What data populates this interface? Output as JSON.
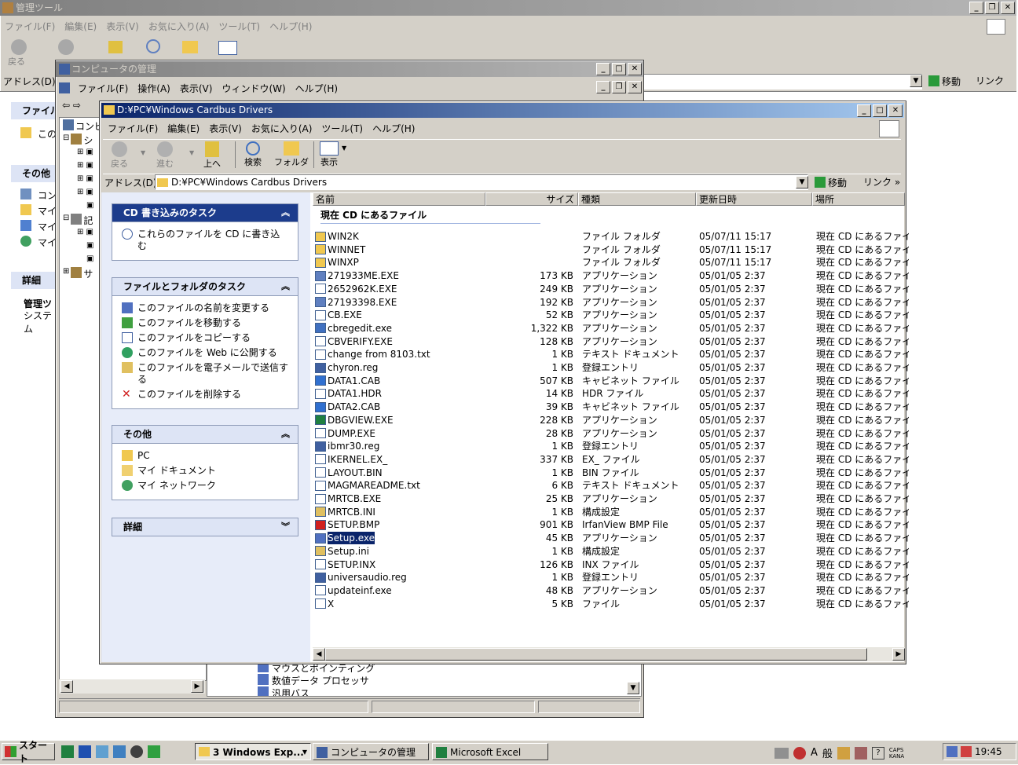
{
  "bg_window": {
    "title": "管理ツール",
    "menu": [
      "ファイル(F)",
      "編集(E)",
      "表示(V)",
      "お気に入り(A)",
      "ツール(T)",
      "ヘルプ(H)"
    ],
    "back_label": "戻る",
    "address_label": "アドレス(D)",
    "go_label": "移動",
    "links_label": "リンク",
    "left": {
      "file_section": "ファイル",
      "file_item": "この",
      "other_section": "その他",
      "other_items": [
        "コン",
        "マイ",
        "マイ",
        "マイ"
      ],
      "detail_section": "詳細",
      "detail_title": "管理ツ",
      "detail_sub": "システム"
    }
  },
  "mmc_window": {
    "title": "コンピュータの管理",
    "menu": [
      "ファイル(F)",
      "操作(A)",
      "表示(V)",
      "ウィンドウ(W)",
      "ヘルプ(H)"
    ],
    "tree_items": [
      "コンピ",
      "シ",
      "記",
      "サ"
    ],
    "bottom_items": [
      "マウスとポインティング",
      "数値データ プロセッサ",
      "汎用バス"
    ]
  },
  "explorer": {
    "title": "D:¥PC¥Windows Cardbus Drivers",
    "menu": [
      "ファイル(F)",
      "編集(E)",
      "表示(V)",
      "お気に入り(A)",
      "ツール(T)",
      "ヘルプ(H)"
    ],
    "toolbar": {
      "back": "戻る",
      "forward": "進む",
      "up": "上へ",
      "search": "検索",
      "folders": "フォルダ",
      "view": "表示"
    },
    "address_label": "アドレス(D)",
    "address_value": "D:¥PC¥Windows Cardbus Drivers",
    "go_label": "移動",
    "links_label": "リンク",
    "tasks": {
      "cd_title": "CD 書き込みのタスク",
      "cd_item": "これらのファイルを CD に書き込む",
      "file_title": "ファイルとフォルダのタスク",
      "file_items": [
        "このファイルの名前を変更する",
        "このファイルを移動する",
        "このファイルをコピーする",
        "このファイルを Web に公開する",
        "このファイルを電子メールで送信する",
        "このファイルを削除する"
      ],
      "other_title": "その他",
      "other_items": [
        "PC",
        "マイ ドキュメント",
        "マイ ネットワーク"
      ],
      "detail_title": "詳細"
    },
    "columns": [
      "名前",
      "サイズ",
      "種類",
      "更新日時",
      "場所"
    ],
    "group_label": "現在 CD にあるファイル",
    "files": [
      {
        "name": "WIN2K",
        "size": "",
        "type": "ファイル フォルダ",
        "date": "05/07/11 15:17",
        "loc": "現在 CD にあるファイ",
        "icon": "folder"
      },
      {
        "name": "WINNET",
        "size": "",
        "type": "ファイル フォルダ",
        "date": "05/07/11 15:17",
        "loc": "現在 CD にあるファイ",
        "icon": "folder"
      },
      {
        "name": "WINXP",
        "size": "",
        "type": "ファイル フォルダ",
        "date": "05/07/11 15:17",
        "loc": "現在 CD にあるファイ",
        "icon": "folder"
      },
      {
        "name": "271933ME.EXE",
        "size": "173 KB",
        "type": "アプリケーション",
        "date": "05/01/05 2:37",
        "loc": "現在 CD にあるファイ",
        "icon": "exe2"
      },
      {
        "name": "2652962K.EXE",
        "size": "249 KB",
        "type": "アプリケーション",
        "date": "05/01/05 2:37",
        "loc": "現在 CD にあるファイ",
        "icon": "exe"
      },
      {
        "name": "27193398.EXE",
        "size": "192 KB",
        "type": "アプリケーション",
        "date": "05/01/05 2:37",
        "loc": "現在 CD にあるファイ",
        "icon": "exe2"
      },
      {
        "name": "CB.EXE",
        "size": "52 KB",
        "type": "アプリケーション",
        "date": "05/01/05 2:37",
        "loc": "現在 CD にあるファイ",
        "icon": "exe"
      },
      {
        "name": "cbregedit.exe",
        "size": "1,322 KB",
        "type": "アプリケーション",
        "date": "05/01/05 2:37",
        "loc": "現在 CD にあるファイ",
        "icon": "regedit"
      },
      {
        "name": "CBVERIFY.EXE",
        "size": "128 KB",
        "type": "アプリケーション",
        "date": "05/01/05 2:37",
        "loc": "現在 CD にあるファイ",
        "icon": "exe"
      },
      {
        "name": "change from 8103.txt",
        "size": "1 KB",
        "type": "テキスト ドキュメント",
        "date": "05/01/05 2:37",
        "loc": "現在 CD にあるファイ",
        "icon": "txt"
      },
      {
        "name": "chyron.reg",
        "size": "1 KB",
        "type": "登録エントリ",
        "date": "05/01/05 2:37",
        "loc": "現在 CD にあるファイ",
        "icon": "reg"
      },
      {
        "name": "DATA1.CAB",
        "size": "507 KB",
        "type": "キャビネット ファイル",
        "date": "05/01/05 2:37",
        "loc": "現在 CD にあるファイ",
        "icon": "cab"
      },
      {
        "name": "DATA1.HDR",
        "size": "14 KB",
        "type": "HDR ファイル",
        "date": "05/01/05 2:37",
        "loc": "現在 CD にあるファイ",
        "icon": "file"
      },
      {
        "name": "DATA2.CAB",
        "size": "39 KB",
        "type": "キャビネット ファイル",
        "date": "05/01/05 2:37",
        "loc": "現在 CD にあるファイ",
        "icon": "cab"
      },
      {
        "name": "DBGVIEW.EXE",
        "size": "228 KB",
        "type": "アプリケーション",
        "date": "05/01/05 2:37",
        "loc": "現在 CD にあるファイ",
        "icon": "dbg"
      },
      {
        "name": "DUMP.EXE",
        "size": "28 KB",
        "type": "アプリケーション",
        "date": "05/01/05 2:37",
        "loc": "現在 CD にあるファイ",
        "icon": "exe"
      },
      {
        "name": "ibmr30.reg",
        "size": "1 KB",
        "type": "登録エントリ",
        "date": "05/01/05 2:37",
        "loc": "現在 CD にあるファイ",
        "icon": "reg"
      },
      {
        "name": "IKERNEL.EX_",
        "size": "337 KB",
        "type": "EX_ ファイル",
        "date": "05/01/05 2:37",
        "loc": "現在 CD にあるファイ",
        "icon": "file"
      },
      {
        "name": "LAYOUT.BIN",
        "size": "1 KB",
        "type": "BIN ファイル",
        "date": "05/01/05 2:37",
        "loc": "現在 CD にあるファイ",
        "icon": "file"
      },
      {
        "name": "MAGMAREADME.txt",
        "size": "6 KB",
        "type": "テキスト ドキュメント",
        "date": "05/01/05 2:37",
        "loc": "現在 CD にあるファイ",
        "icon": "txt"
      },
      {
        "name": "MRTCB.EXE",
        "size": "25 KB",
        "type": "アプリケーション",
        "date": "05/01/05 2:37",
        "loc": "現在 CD にあるファイ",
        "icon": "exe"
      },
      {
        "name": "MRTCB.INI",
        "size": "1 KB",
        "type": "構成設定",
        "date": "05/01/05 2:37",
        "loc": "現在 CD にあるファイ",
        "icon": "ini"
      },
      {
        "name": "SETUP.BMP",
        "size": "901 KB",
        "type": "IrfanView BMP File",
        "date": "05/01/05 2:37",
        "loc": "現在 CD にあるファイ",
        "icon": "bmp"
      },
      {
        "name": "Setup.exe",
        "size": "45 KB",
        "type": "アプリケーション",
        "date": "05/01/05 2:37",
        "loc": "現在 CD にあるファイ",
        "icon": "setup",
        "selected": true
      },
      {
        "name": "Setup.ini",
        "size": "1 KB",
        "type": "構成設定",
        "date": "05/01/05 2:37",
        "loc": "現在 CD にあるファイ",
        "icon": "ini"
      },
      {
        "name": "SETUP.INX",
        "size": "126 KB",
        "type": "INX ファイル",
        "date": "05/01/05 2:37",
        "loc": "現在 CD にあるファイ",
        "icon": "file"
      },
      {
        "name": "universaudio.reg",
        "size": "1 KB",
        "type": "登録エントリ",
        "date": "05/01/05 2:37",
        "loc": "現在 CD にあるファイ",
        "icon": "reg"
      },
      {
        "name": "updateinf.exe",
        "size": "48 KB",
        "type": "アプリケーション",
        "date": "05/01/05 2:37",
        "loc": "現在 CD にあるファイ",
        "icon": "exe"
      },
      {
        "name": "X",
        "size": "5 KB",
        "type": "ファイル",
        "date": "05/01/05 2:37",
        "loc": "現在 CD にあるファイ",
        "icon": "file"
      }
    ]
  },
  "taskbar": {
    "start": "スタート",
    "tasks": [
      "3 Windows Exp...",
      "コンピュータの管理",
      "Microsoft Excel"
    ],
    "ime_a": "A",
    "ime_mode": "般",
    "caps": "CAPS",
    "kana": "KANA",
    "clock": "19:45"
  },
  "colors": {
    "title_active": "#0a246a",
    "title_inactive": "#808080",
    "face": "#d4d0c8",
    "selection": "#0a246a"
  }
}
